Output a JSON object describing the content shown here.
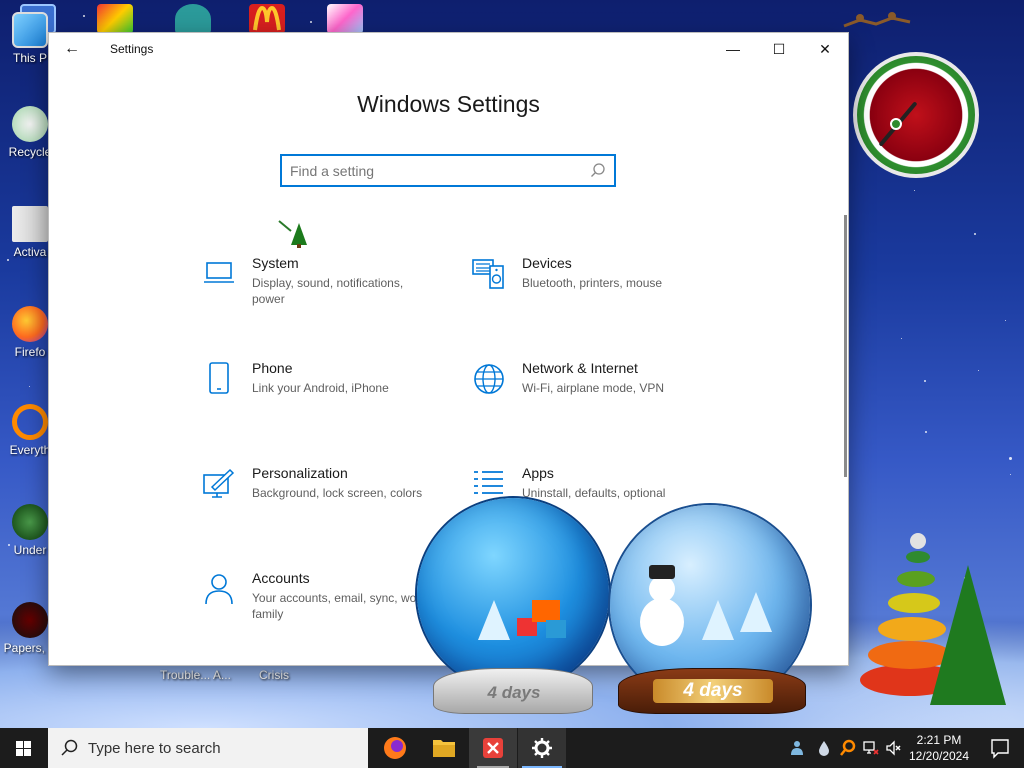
{
  "desktop": {
    "icons": [
      {
        "label": "This P"
      },
      {
        "label": "Recycle"
      },
      {
        "label": "Activa"
      },
      {
        "label": "Firefo"
      },
      {
        "label": "Everyth"
      },
      {
        "label": "Under"
      },
      {
        "label": "Papers, P"
      }
    ],
    "bottom_labels": [
      "Trouble... A...",
      "Crisis"
    ]
  },
  "window": {
    "title": "Settings",
    "heading": "Windows Settings",
    "search_placeholder": "Find a setting",
    "controls": {
      "minimize": "—",
      "maximize": "☐",
      "close": "✕",
      "back": "←"
    },
    "categories": [
      {
        "title": "System",
        "desc": "Display, sound, notifications, power",
        "icon": "laptop-icon"
      },
      {
        "title": "Devices",
        "desc": "Bluetooth, printers, mouse",
        "icon": "keyboard-speaker-icon"
      },
      {
        "title": "Phone",
        "desc": "Link your Android, iPhone",
        "icon": "phone-icon"
      },
      {
        "title": "Network & Internet",
        "desc": "Wi-Fi, airplane mode, VPN",
        "icon": "globe-icon"
      },
      {
        "title": "Personalization",
        "desc": "Background, lock screen, colors",
        "icon": "paintbrush-icon"
      },
      {
        "title": "Apps",
        "desc": "Uninstall, defaults, optional",
        "icon": "apps-list-icon"
      },
      {
        "title": "Accounts",
        "desc": "Your accounts, email, sync, work, family",
        "icon": "person-icon"
      }
    ]
  },
  "widgets": {
    "globe1_label": "4 days",
    "globe2_label": "4 days"
  },
  "taskbar": {
    "search_text": "Type here to search",
    "apps": [
      "firefox-icon",
      "file-explorer-icon",
      "red-x-app-icon",
      "settings-gear-icon"
    ],
    "tray": {
      "time": "2:21 PM",
      "date": "12/20/2024"
    }
  },
  "colors": {
    "accent": "#0078d7",
    "taskbar": "#1c1c1c",
    "window": "#ffffff"
  }
}
